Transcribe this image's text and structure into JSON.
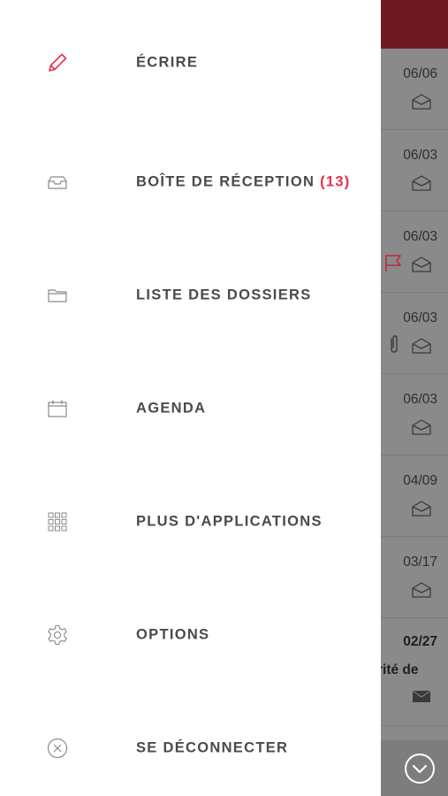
{
  "menu": {
    "items": [
      {
        "id": "compose",
        "label": "ÉCRIRE",
        "icon": "pencil-icon",
        "icon_color": "#e8304a"
      },
      {
        "id": "inbox",
        "label": "BOÎTE DE RÉCEPTION",
        "count": "(13)",
        "icon": "inbox-tray-icon"
      },
      {
        "id": "folders",
        "label": "LISTE DES DOSSIERS",
        "icon": "folder-icon"
      },
      {
        "id": "calendar",
        "label": "AGENDA",
        "icon": "calendar-icon"
      },
      {
        "id": "apps",
        "label": "PLUS D'APPLICATIONS",
        "icon": "app-grid-icon"
      },
      {
        "id": "options",
        "label": "OPTIONS",
        "icon": "gear-icon"
      },
      {
        "id": "logout",
        "label": "SE DÉCONNECTER",
        "icon": "close-circle-icon"
      }
    ],
    "count_color": "#e8304a",
    "label_color": "#4a4a4a"
  },
  "background_list": {
    "header_color": "#6f1a22",
    "messages": [
      {
        "date": "06/06",
        "icon": "envelope-open-icon"
      },
      {
        "date": "06/03",
        "icon": "envelope-open-icon"
      },
      {
        "date": "06/03",
        "icon": "envelope-open-icon",
        "extra_icon": "flag-icon",
        "flag_color": "#c0283a"
      },
      {
        "date": "06/03",
        "icon": "envelope-open-icon",
        "extra_icon": "paperclip-icon"
      },
      {
        "date": "06/03",
        "icon": "envelope-open-icon"
      },
      {
        "date": "04/09",
        "icon": "envelope-open-icon"
      },
      {
        "date": "03/17",
        "icon": "envelope-open-icon"
      },
      {
        "date": "02/27",
        "snippet": "rité de",
        "unread": true,
        "icon": "envelope-closed-icon"
      }
    ],
    "footer_icon": "chevron-down-circle-icon"
  }
}
